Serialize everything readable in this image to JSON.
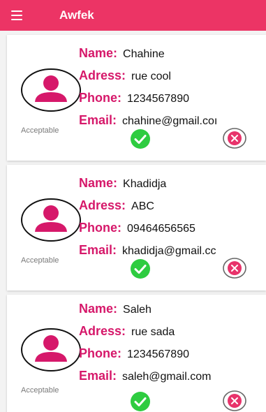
{
  "app": {
    "title": "Awfek",
    "accent_color": "#ec3465",
    "key_color": "#d6186a",
    "accept_color": "#2ecc40",
    "reject_color": "#e8336b"
  },
  "labels": {
    "name": "Name:",
    "adress": "Adress:",
    "phone": "Phone:",
    "email": "Email:",
    "acceptable": "Acceptable"
  },
  "contacts": [
    {
      "name": "Chahine",
      "adress": "rue cool",
      "phone": "1234567890",
      "email": "chahine@gmail.coı"
    },
    {
      "name": "Khadidja",
      "adress": "ABC",
      "phone": "09464656565",
      "email": "khadidja@gmail.cc"
    },
    {
      "name": "Saleh",
      "adress": "rue sada",
      "phone": "1234567890",
      "email": "saleh@gmail.com"
    }
  ],
  "icons": {
    "menu": "menu-icon",
    "avatar": "user-avatar-icon",
    "accept": "check-circle-icon",
    "reject": "close-circle-icon"
  }
}
